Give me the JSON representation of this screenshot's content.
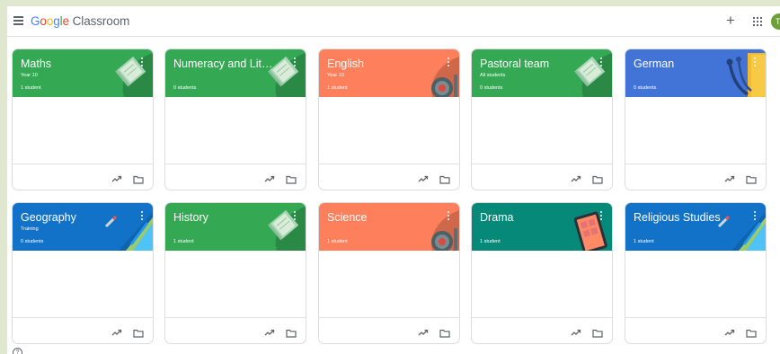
{
  "app": {
    "title_google": "Google",
    "title_product": "Classroom",
    "avatar_initial": "T"
  },
  "icons": {
    "menu": "menu-icon",
    "add": "plus-icon",
    "apps": "apps-grid-icon",
    "more": "more-vert-icon",
    "stats": "trending-icon",
    "folder": "folder-icon",
    "help": "help-icon"
  },
  "cards": [
    {
      "title": "Maths",
      "section": "Year 10",
      "count": "1 student",
      "color": "#34a853",
      "theme": "book"
    },
    {
      "title": "Numeracy and Literacy",
      "section": "",
      "count": "0 students",
      "color": "#34a853",
      "theme": "book"
    },
    {
      "title": "English",
      "section": "Year 10",
      "count": "1 student",
      "color": "#fd7f5b",
      "theme": "lab"
    },
    {
      "title": "Pastoral team",
      "section": "All students",
      "count": "0 students",
      "color": "#34a853",
      "theme": "book"
    },
    {
      "title": "German",
      "section": "",
      "count": "0 students",
      "color": "#4273d7",
      "theme": "music"
    },
    {
      "title": "Geography",
      "section": "Training",
      "count": "0 students",
      "color": "#1272c7",
      "theme": "pencil"
    },
    {
      "title": "History",
      "section": "",
      "count": "1 student",
      "color": "#34a853",
      "theme": "book"
    },
    {
      "title": "Science",
      "section": "",
      "count": "1 student",
      "color": "#fd7f5b",
      "theme": "lab"
    },
    {
      "title": "Drama",
      "section": "",
      "count": "1 student",
      "color": "#07897a",
      "theme": "tablet"
    },
    {
      "title": "Religious Studies",
      "section": "",
      "count": "1 student",
      "color": "#1272c7",
      "theme": "pencil"
    }
  ]
}
